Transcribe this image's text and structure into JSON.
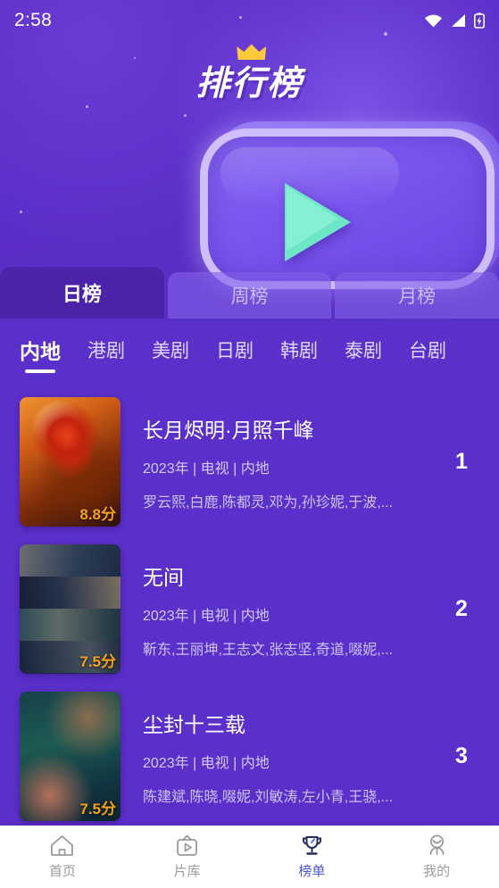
{
  "status_bar": {
    "time": "2:58",
    "icons": [
      "wifi-icon",
      "signal-icon",
      "battery-charging-icon"
    ]
  },
  "header": {
    "logo_text": "排行榜",
    "crown_icon": "crown-icon",
    "banner_icon": "tv-play-icon"
  },
  "period_tabs": [
    {
      "label": "日榜",
      "active": true
    },
    {
      "label": "周榜",
      "active": false
    },
    {
      "label": "月榜",
      "active": false
    }
  ],
  "category_tabs": [
    {
      "label": "内地",
      "active": true
    },
    {
      "label": "港剧",
      "active": false
    },
    {
      "label": "美剧",
      "active": false
    },
    {
      "label": "日剧",
      "active": false
    },
    {
      "label": "韩剧",
      "active": false
    },
    {
      "label": "泰剧",
      "active": false
    },
    {
      "label": "台剧",
      "active": false
    }
  ],
  "list": [
    {
      "rank": "1",
      "title": "长月烬明·月照千峰",
      "meta": "2023年 | 电视 | 内地",
      "cast": "罗云熙,白鹿,陈都灵,邓为,孙珍妮,于波,...",
      "score": "8.8分"
    },
    {
      "rank": "2",
      "title": "无间",
      "meta": "2023年 | 电视 | 内地",
      "cast": "靳东,王丽坤,王志文,张志坚,奇道,啜妮,...",
      "score": "7.5分"
    },
    {
      "rank": "3",
      "title": "尘封十三载",
      "meta": "2023年 | 电视 | 内地",
      "cast": "陈建斌,陈晓,啜妮,刘敏涛,左小青,王骁,...",
      "score": "7.5分"
    }
  ],
  "bottom_nav": [
    {
      "label": "首页",
      "icon": "home-icon",
      "active": false
    },
    {
      "label": "片库",
      "icon": "tv-library-icon",
      "active": false
    },
    {
      "label": "榜单",
      "icon": "trophy-icon",
      "active": true
    },
    {
      "label": "我的",
      "icon": "user-icon",
      "active": false
    }
  ],
  "colors": {
    "background": "#5b2fc9",
    "active_tab": "#4a23a8",
    "accent_play": "#6de6c8",
    "score": "#f7a11c",
    "nav_active": "#4a55d8"
  }
}
